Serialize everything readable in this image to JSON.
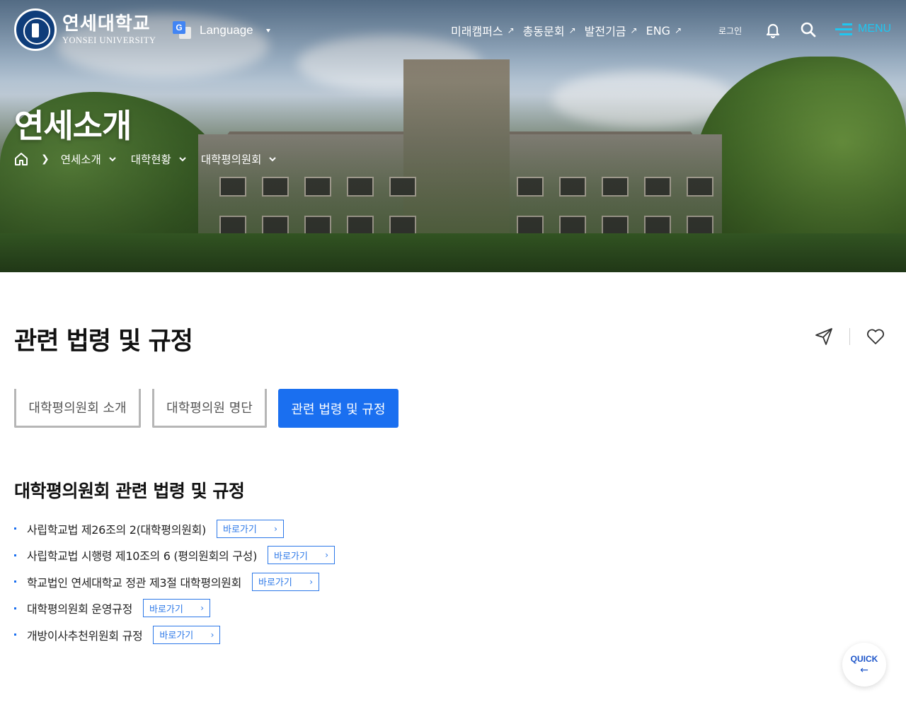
{
  "header": {
    "logo": {
      "name_ko": "연세대학교",
      "name_en": "YONSEI UNIVERSITY"
    },
    "language": {
      "label": "Language",
      "icon": "google-translate-icon"
    },
    "nav": [
      {
        "label": "미래캠퍼스",
        "arrow": "↗"
      },
      {
        "label": "총동문회",
        "arrow": "↗"
      },
      {
        "label": "발전기금",
        "arrow": "↗"
      },
      {
        "label": "ENG",
        "arrow": "↗"
      }
    ],
    "login_label": "로그인",
    "menu_label": "MENU",
    "accent_color": "#1fc6f0"
  },
  "hero": {
    "title": "연세소개",
    "breadcrumb": [
      {
        "label": "연세소개"
      },
      {
        "label": "대학현황"
      },
      {
        "label": "대학평의원회"
      }
    ]
  },
  "content": {
    "title": "관련 법령 및 규정",
    "tabs": [
      {
        "label": "대학평의원회 소개",
        "active": false
      },
      {
        "label": "대학평의원 명단",
        "active": false
      },
      {
        "label": "관련 법령 및 규정",
        "active": true
      }
    ],
    "list_title": "대학평의원회 관련 법령 및 규정",
    "regulations": [
      {
        "text": "사립학교법 제26조의 2(대학평의원회)",
        "button": "바로가기"
      },
      {
        "text": "사립학교법 시행령 제10조의 6 (평의원회의 구성)",
        "button": "바로가기"
      },
      {
        "text": "학교법인 연세대학교 정관 제3절 대학평의원회",
        "button": "바로가기"
      },
      {
        "text": "대학평의원회 운영규정",
        "button": "바로가기"
      },
      {
        "text": "개방이사추천위원회 규정",
        "button": "바로가기"
      }
    ],
    "primary_color": "#1a6ff0"
  },
  "quick": {
    "label": "QUICK",
    "arrow": "←"
  }
}
